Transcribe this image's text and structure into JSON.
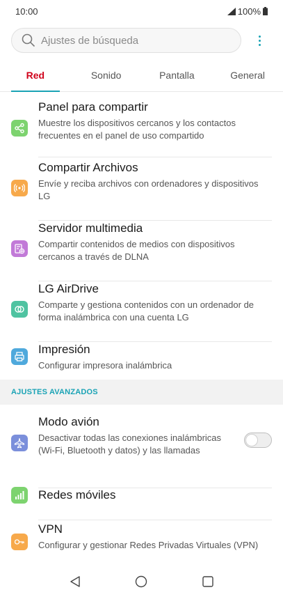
{
  "status_bar": {
    "time": "10:00",
    "battery": "100%"
  },
  "search": {
    "placeholder": "Ajustes de búsqueda"
  },
  "tabs": [
    {
      "label": "Red"
    },
    {
      "label": "Sonido"
    },
    {
      "label": "Pantalla"
    },
    {
      "label": "General"
    }
  ],
  "items": [
    {
      "title": "Panel para compartir",
      "desc": "Muestre los dispositivos cercanos y los contactos frecuentes en el panel de uso compartido",
      "icon": "share-icon",
      "color": "#7dd36f"
    },
    {
      "title": "Compartir Archivos",
      "desc": "Envíe y reciba archivos con ordenadores y dispositivos LG",
      "icon": "file-share-icon",
      "color": "#f7a94b"
    },
    {
      "title": "Servidor multimedia",
      "desc": "Compartir contenidos de medios con dispositivos cercanos a través de DLNA",
      "icon": "media-server-icon",
      "color": "#c27ad8"
    },
    {
      "title": "LG AirDrive",
      "desc": "Comparte y gestiona contenidos con un ordenador de forma inalámbrica con una cuenta LG",
      "icon": "airdrive-icon",
      "color": "#4fc3a1"
    },
    {
      "title": "Impresión",
      "desc": "Configurar impresora inalámbrica",
      "icon": "printer-icon",
      "color": "#4fa9dc"
    }
  ],
  "advanced": {
    "header": "AJUSTES AVANZADOS",
    "items": [
      {
        "title": "Modo avión",
        "desc": "Desactivar todas las conexiones inalámbricas (Wi-Fi, Bluetooth y datos) y las llamadas",
        "icon": "airplane-icon",
        "color": "#7b8fdb",
        "toggle": "off"
      },
      {
        "title": "Redes móviles",
        "desc": "",
        "icon": "signal-bars-icon",
        "color": "#7dd36f"
      },
      {
        "title": "VPN",
        "desc": "Configurar y gestionar Redes Privadas Virtuales (VPN)",
        "icon": "key-icon",
        "color": "#f7a94b"
      }
    ]
  },
  "accent_color": "#1aa3b5",
  "active_tab_color": "#d0021b"
}
